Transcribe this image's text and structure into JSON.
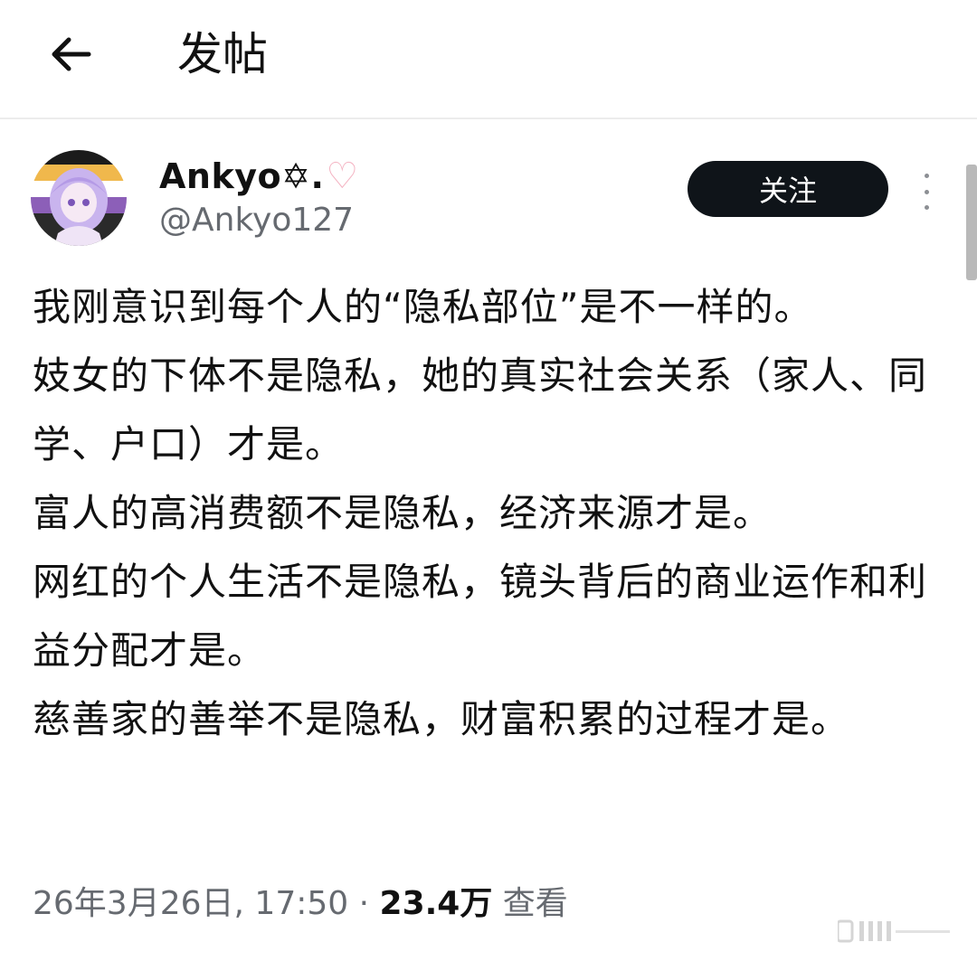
{
  "header": {
    "title": "发帖",
    "back_icon": "arrow-left-icon"
  },
  "author": {
    "display_name": "Ankyo",
    "name_suffix": "✡.",
    "heart": "♡",
    "handle": "@Ankyo127",
    "avatar": "anime-avatar"
  },
  "follow_label": "关注",
  "more_icon": "more-vertical-icon",
  "post": {
    "paragraphs": [
      "我刚意识到每个人的“隐私部位”是不一样的。",
      "妓女的下体不是隐私，她的真实社会关系（家人、同学、户口）才是。",
      "富人的高消费额不是隐私，经济来源才是。",
      "网红的个人生活不是隐私，镜头背后的商业运作和利益分配才是。",
      "慈善家的善举不是隐私，财富积累的过程才是。"
    ]
  },
  "meta": {
    "timestamp": "26年3月26日, 17:50",
    "separator": "·",
    "views": "23.4万",
    "views_label": "查看"
  },
  "colors": {
    "follow_bg": "#0f1419",
    "meta_gray": "#666a70",
    "heart_pink": "#f4b3c2"
  }
}
